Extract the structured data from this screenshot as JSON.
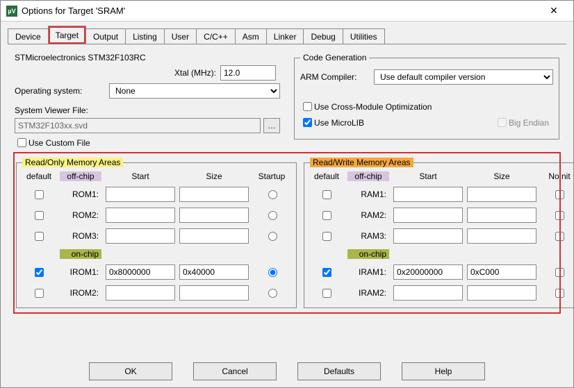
{
  "window": {
    "title": "Options for Target 'SRAM'"
  },
  "tabs": {
    "device": "Device",
    "target": "Target",
    "output": "Output",
    "listing": "Listing",
    "user": "User",
    "cpp": "C/C++",
    "asm": "Asm",
    "linker": "Linker",
    "debug": "Debug",
    "utilities": "Utilities"
  },
  "top": {
    "mcu": "STMicroelectronics STM32F103RC",
    "xtal_label": "Xtal (MHz):",
    "xtal_value": "12.0",
    "opsys_label": "Operating system:",
    "opsys_value": "None",
    "svd_label": "System Viewer File:",
    "svd_value": "STM32F103xx.svd",
    "use_custom": "Use Custom File"
  },
  "codegen": {
    "legend": "Code Generation",
    "arm_compiler_label": "ARM Compiler:",
    "arm_compiler_value": "Use default compiler version",
    "cross_module": "Use Cross-Module Optimization",
    "microlib": "Use MicroLIB",
    "big_endian": "Big Endian"
  },
  "rom": {
    "legend": "Read/Only Memory Areas",
    "hdr_default": "default",
    "hdr_offchip": "off-chip",
    "hdr_start": "Start",
    "hdr_size": "Size",
    "hdr_startup": "Startup",
    "hdr_onchip": "on-chip",
    "rows": {
      "rom1": "ROM1:",
      "rom2": "ROM2:",
      "rom3": "ROM3:",
      "irom1": "IROM1:",
      "irom2": "IROM2:"
    },
    "values": {
      "irom1_start": "0x8000000",
      "irom1_size": "0x40000"
    }
  },
  "ram": {
    "legend": "Read/Write Memory Areas",
    "hdr_default": "default",
    "hdr_offchip": "off-chip",
    "hdr_start": "Start",
    "hdr_size": "Size",
    "hdr_noinit": "NoInit",
    "hdr_onchip": "on-chip",
    "rows": {
      "ram1": "RAM1:",
      "ram2": "RAM2:",
      "ram3": "RAM3:",
      "iram1": "IRAM1:",
      "iram2": "IRAM2:"
    },
    "values": {
      "iram1_start": "0x20000000",
      "iram1_size": "0xC000"
    }
  },
  "buttons": {
    "ok": "OK",
    "cancel": "Cancel",
    "defaults": "Defaults",
    "help": "Help"
  }
}
